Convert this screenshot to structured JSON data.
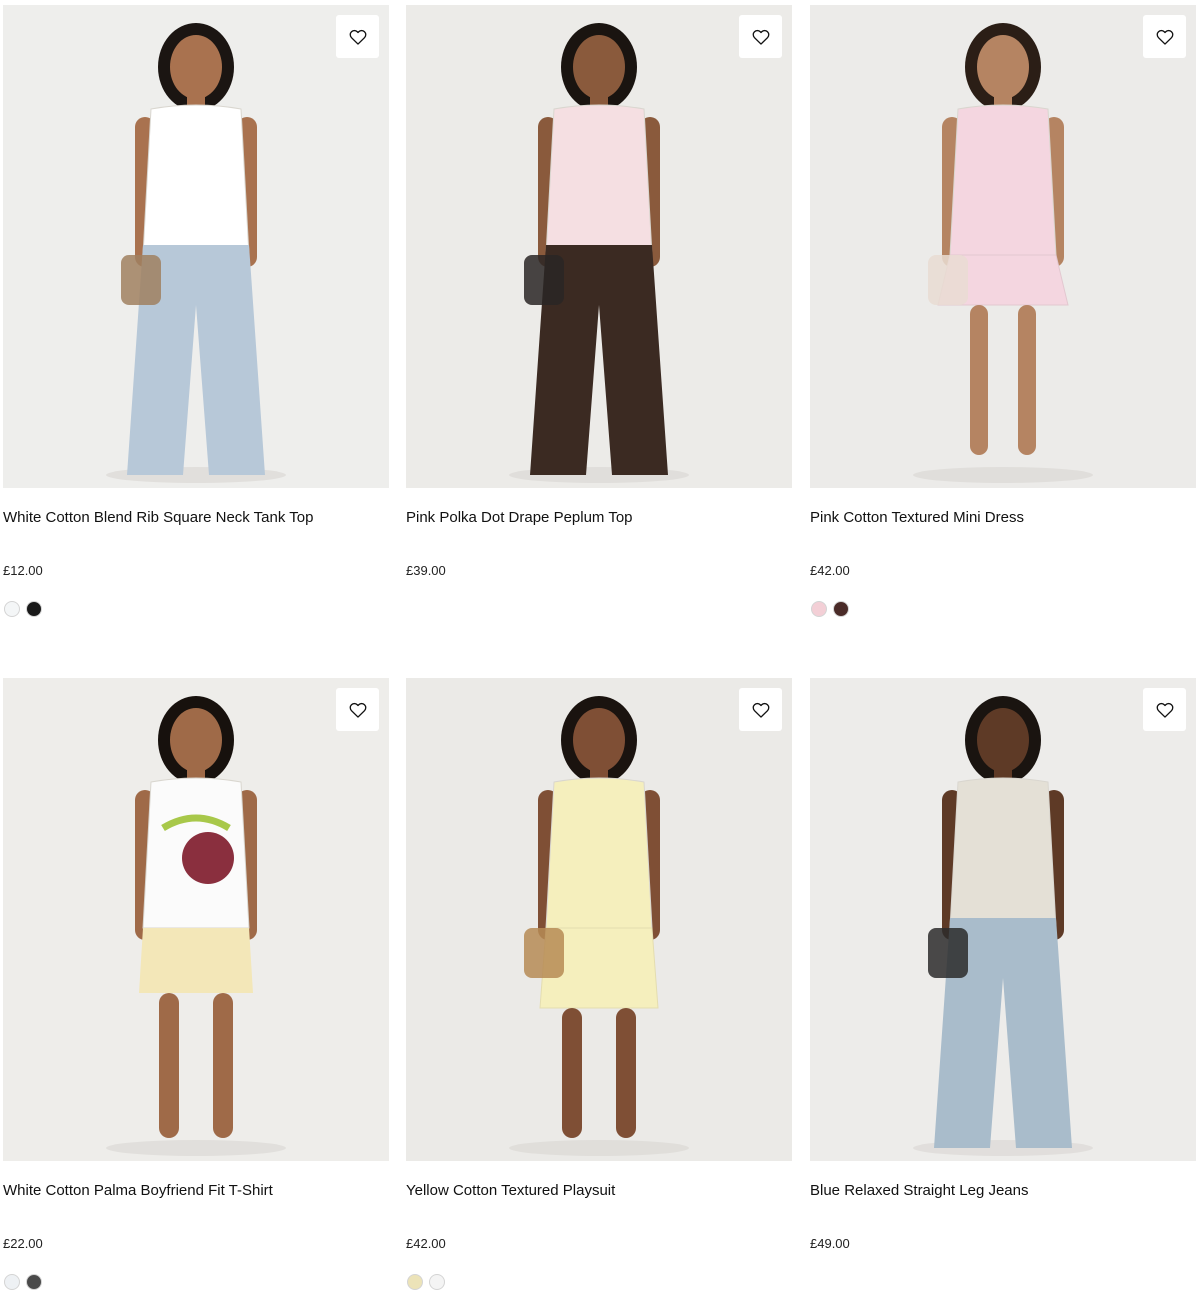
{
  "products": [
    {
      "name": "White Cotton Blend Rib Square Neck Tank Top",
      "price": "£12.00",
      "swatches": [
        "#f4f6f7",
        "#1a1a1a"
      ],
      "photo": {
        "bg": "#eeeeec",
        "top": "#ffffff",
        "bottom": "#b7c8d8",
        "skin": "#a9724f",
        "hair": "#1b1512",
        "accent": "#a08060"
      }
    },
    {
      "name": "Pink Polka Dot Drape Peplum Top",
      "price": "£39.00",
      "swatches": [],
      "photo": {
        "bg": "#ecebe8",
        "top": "#f5dfe2",
        "bottom": "#3b2a22",
        "skin": "#8a5a3c",
        "hair": "#1a1410",
        "accent": "#2a2624"
      }
    },
    {
      "name": "Pink Cotton Textured Mini Dress",
      "price": "£42.00",
      "swatches": [
        "#f3cfd6",
        "#4a2b28"
      ],
      "photo": {
        "bg": "#ecebe9",
        "top": "#f4d6e0",
        "bottom": "#f4d6e0",
        "skin": "#b58462",
        "hair": "#2b1e16",
        "accent": "#e9dcd2"
      }
    },
    {
      "name": "White Cotton Palma Boyfriend Fit T-Shirt",
      "price": "£22.00",
      "swatches": [
        "#eef1f4",
        "#4a4a4a"
      ],
      "photo": {
        "bg": "#eeedea",
        "top": "#fbfbfb",
        "bottom": "#f3e7b8",
        "skin": "#9f6a48",
        "hair": "#17110d",
        "accent": "#a8c84a"
      }
    },
    {
      "name": "Yellow Cotton Textured Playsuit",
      "price": "£42.00",
      "swatches": [
        "#ece3b8",
        "#f4f4f4"
      ],
      "photo": {
        "bg": "#ebeae7",
        "top": "#f5efbd",
        "bottom": "#f5efbd",
        "skin": "#7f4f35",
        "hair": "#1a130f",
        "accent": "#b68b55"
      }
    },
    {
      "name": "Blue Relaxed Straight Leg Jeans",
      "price": "£49.00",
      "swatches": [],
      "photo": {
        "bg": "#edecea",
        "top": "#e4e0d6",
        "bottom": "#a9bccb",
        "skin": "#5e3a26",
        "hair": "#1a1410",
        "accent": "#2b2b2b"
      }
    }
  ]
}
